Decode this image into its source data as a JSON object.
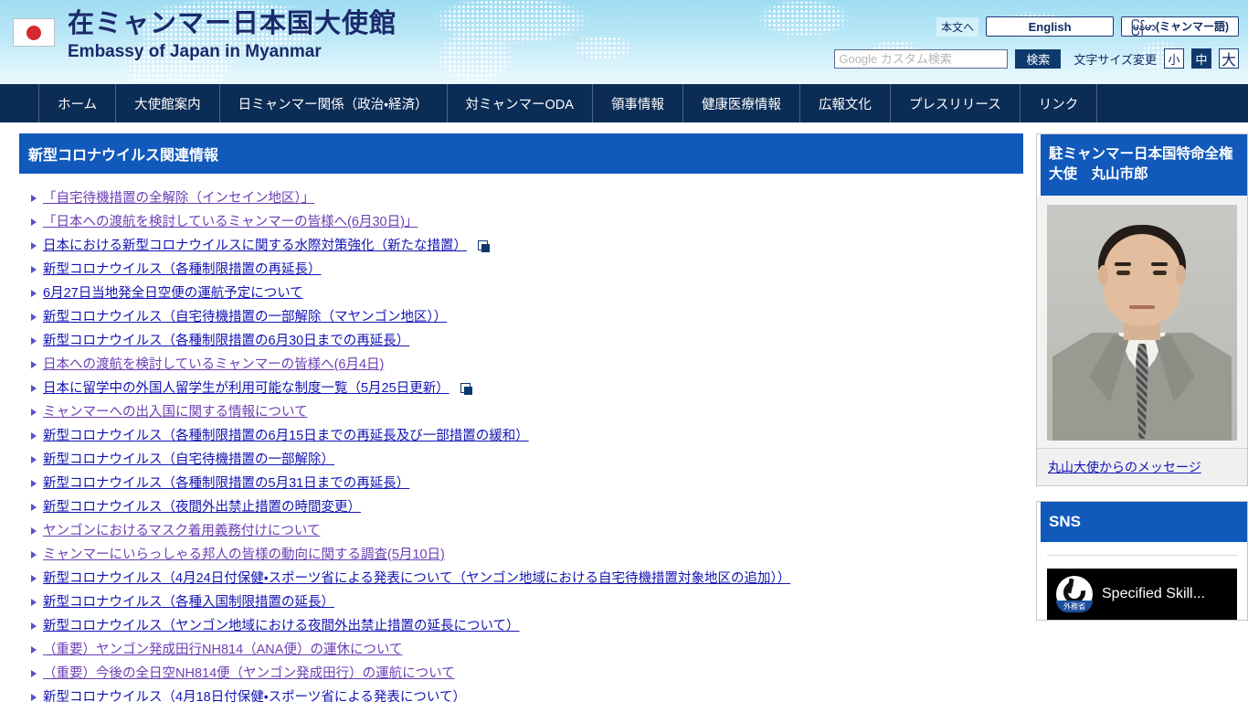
{
  "header": {
    "flag_icon": "japan-flag-icon",
    "title_jp": "在ミャンマー日本国大使館",
    "title_en": "Embassy of Japan in Myanmar",
    "skip_link": "本文へ",
    "lang_english": "English",
    "lang_myanmar": "မြန်မာ(ミャンマー語)",
    "search_placeholder": "Google カスタム検索",
    "search_value": "",
    "search_button": "検索",
    "fontsize_label": "文字サイズ変更",
    "fontsize_options": [
      "小",
      "中",
      "大"
    ],
    "fontsize_selected": "中",
    "accent_color": "#0b2c55",
    "heading_color": "#1159bb"
  },
  "nav": {
    "items": [
      "ホーム",
      "大使館案内",
      "日ミャンマー関係（政治・経済）",
      "対ミャンマーODA",
      "領事情報",
      "健康医療情報",
      "広報文化",
      "プレスリリース",
      "リンク"
    ]
  },
  "main": {
    "section_title": "新型コロナウイルス関連情報",
    "links": [
      {
        "text": "「自宅待機措置の全解除（インセイン地区）」",
        "visited": true,
        "external": false
      },
      {
        "text": "「日本への渡航を検討しているミャンマーの皆様へ(6月30日)」",
        "visited": true,
        "external": false
      },
      {
        "text": "日本における新型コロナウイルスに関する水際対策強化（新たな措置）",
        "visited": false,
        "external": true
      },
      {
        "text": "新型コロナウイルス（各種制限措置の再延長）",
        "visited": false,
        "external": false
      },
      {
        "text": "6月27日当地発全日空便の運航予定について",
        "visited": false,
        "external": false
      },
      {
        "text": "新型コロナウイルス（自宅待機措置の一部解除（マヤンゴン地区））",
        "visited": false,
        "external": false
      },
      {
        "text": "新型コロナウイルス（各種制限措置の6月30日までの再延長）",
        "visited": false,
        "external": false
      },
      {
        "text": "日本への渡航を検討しているミャンマーの皆様へ(6月4日)",
        "visited": true,
        "external": false
      },
      {
        "text": "日本に留学中の外国人留学生が利用可能な制度一覧（5月25日更新）",
        "visited": false,
        "external": true
      },
      {
        "text": "ミャンマーへの出入国に関する情報について",
        "visited": true,
        "external": false
      },
      {
        "text": "新型コロナウイルス（各種制限措置の6月15日までの再延長及び一部措置の緩和）",
        "visited": false,
        "external": false
      },
      {
        "text": "新型コロナウイルス（自宅待機措置の一部解除）",
        "visited": false,
        "external": false
      },
      {
        "text": "新型コロナウイルス（各種制限措置の5月31日までの再延長）",
        "visited": false,
        "external": false
      },
      {
        "text": "新型コロナウイルス（夜間外出禁止措置の時間変更）",
        "visited": false,
        "external": false
      },
      {
        "text": "ヤンゴンにおけるマスク着用義務付けについて",
        "visited": true,
        "external": false
      },
      {
        "text": "ミャンマーにいらっしゃる邦人の皆様の動向に関する調査(5月10日)",
        "visited": true,
        "external": false
      },
      {
        "text": "新型コロナウイルス（4月24日付保健・スポーツ省による発表について（ヤンゴン地域における自宅待機措置対象地区の追加））",
        "visited": false,
        "external": false
      },
      {
        "text": "新型コロナウイルス（各種入国制限措置の延長）",
        "visited": false,
        "external": false
      },
      {
        "text": "新型コロナウイルス（ヤンゴン地域における夜間外出禁止措置の延長について）",
        "visited": false,
        "external": false
      },
      {
        "text": "（重要）ヤンゴン発成田行NH814（ANA便）の運休について",
        "visited": true,
        "external": false
      },
      {
        "text": "（重要）今後の全日空NH814便（ヤンゴン発成田行）の運航について",
        "visited": true,
        "external": false
      },
      {
        "text": "新型コロナウイルス（4月18日付保健・スポーツ省による発表について）",
        "visited": false,
        "external": false
      }
    ]
  },
  "sidebar": {
    "ambassador": {
      "title": "駐ミャンマー日本国特命全権大使　丸山市郎",
      "photo_alt": "ambassador-portrait",
      "message_link": "丸山大使からのメッセージ"
    },
    "sns": {
      "title": "SNS",
      "video_title": "Specified Skill...",
      "video_logo_label": "外務省"
    }
  }
}
